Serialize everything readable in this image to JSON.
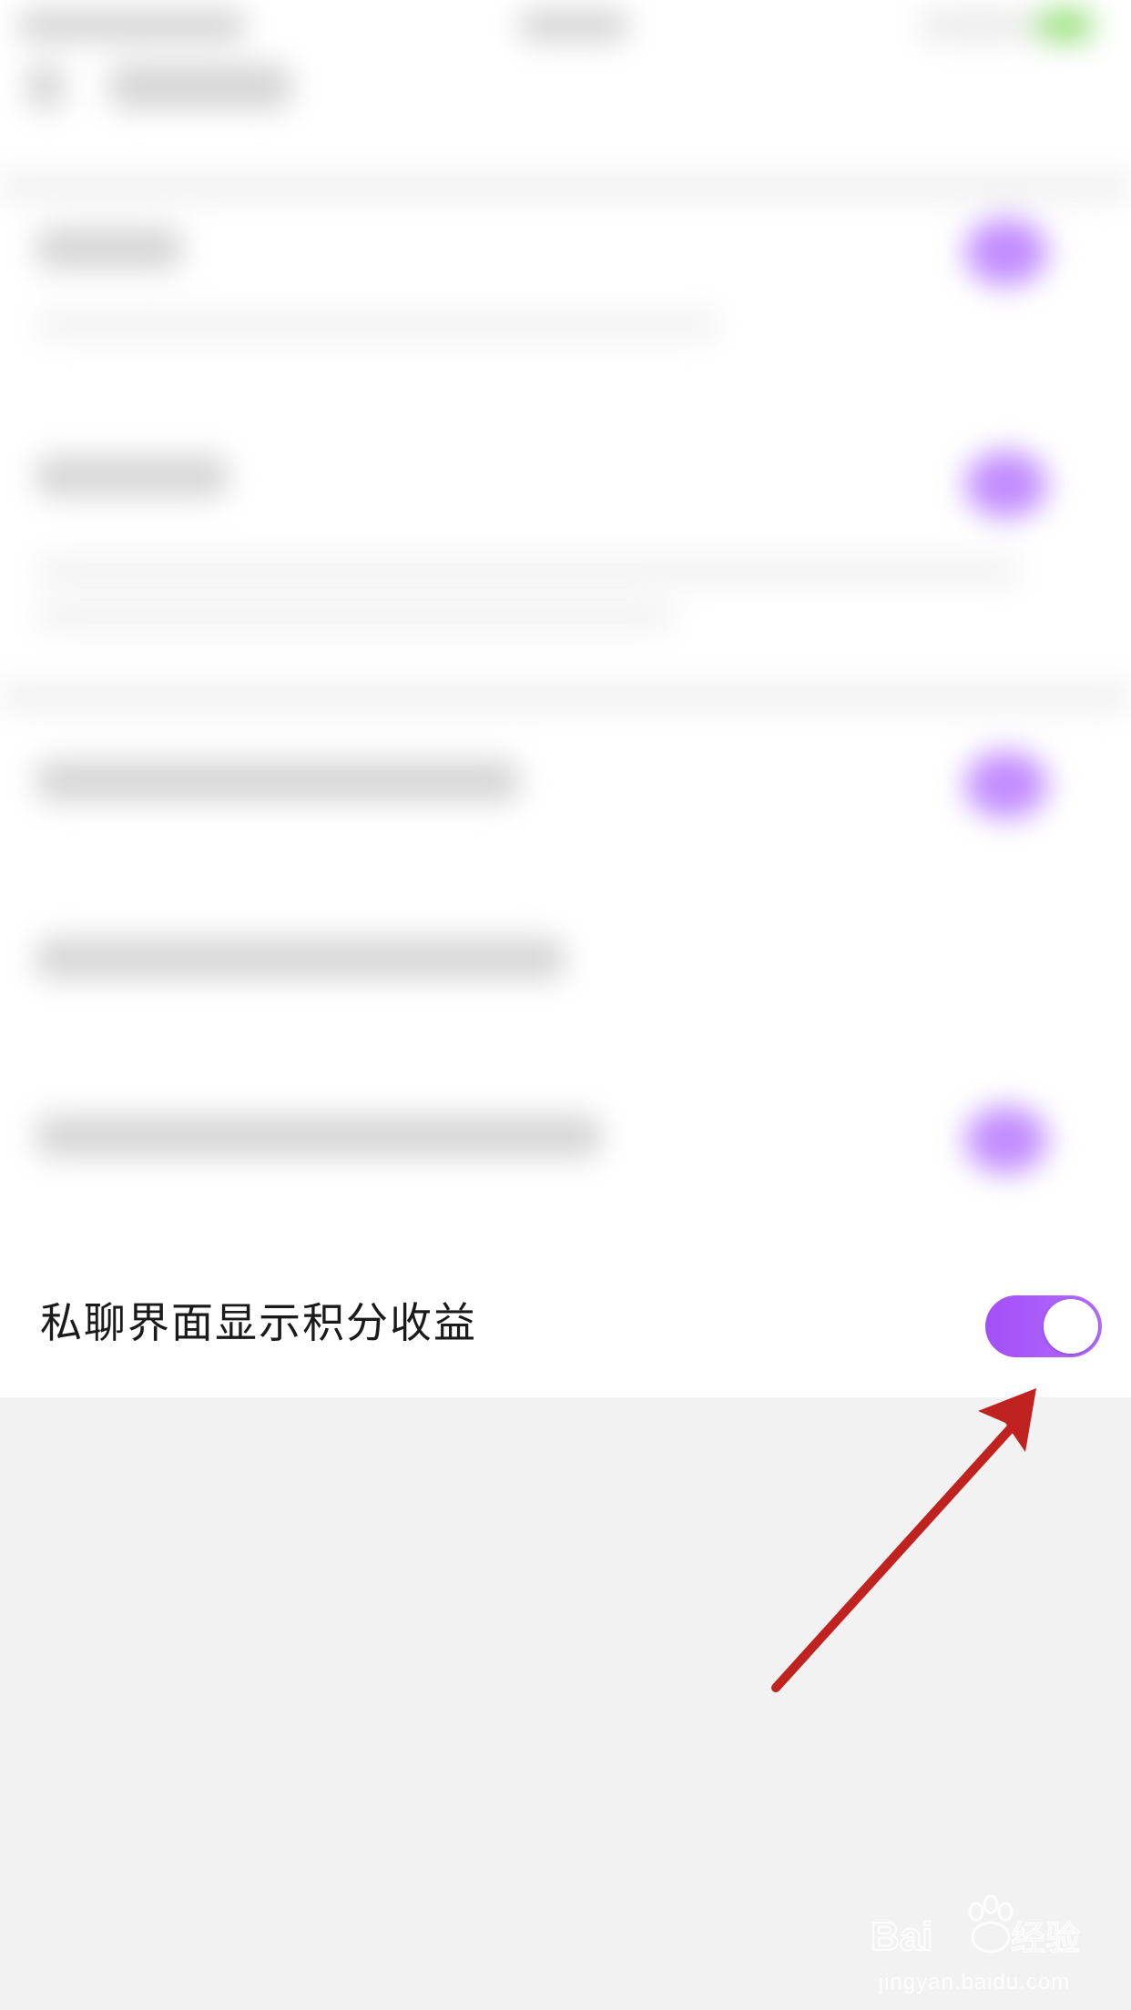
{
  "setting": {
    "label": "私聊界面显示积分收益",
    "enabled": true
  },
  "colors": {
    "toggle_on": "#a24ff7",
    "arrow": "#c0221f",
    "background": "#f2f2f2",
    "row_background": "#ffffff"
  },
  "watermark": {
    "logo": "Baidu经验",
    "url": "jingyan.baidu.com"
  }
}
